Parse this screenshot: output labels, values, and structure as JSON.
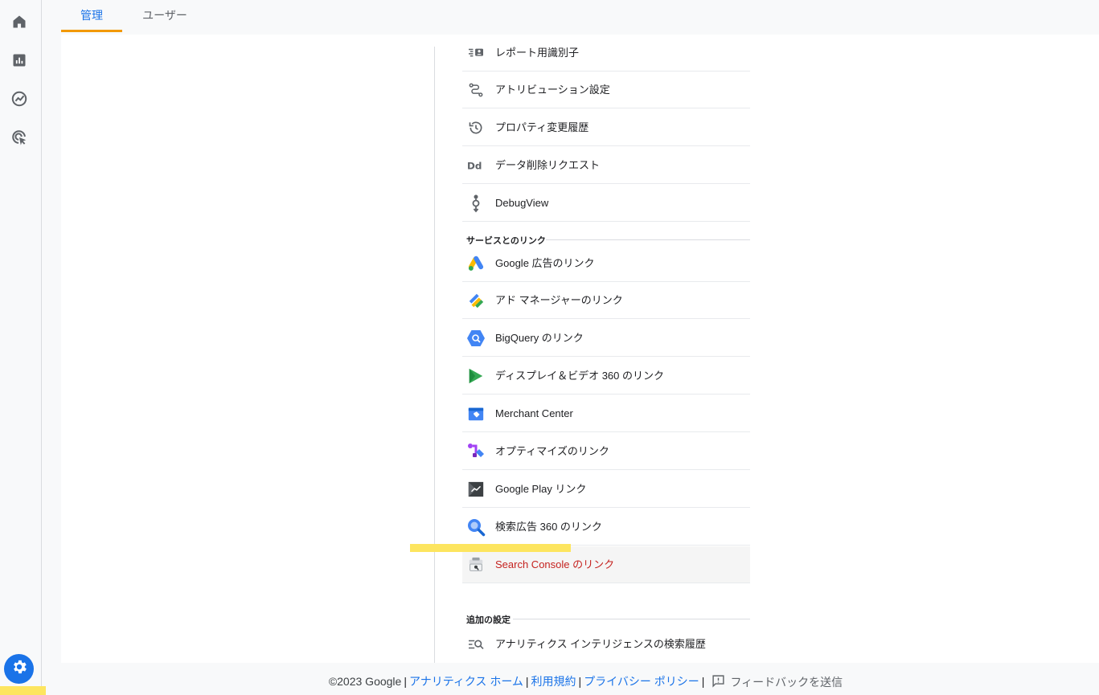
{
  "tabs": [
    {
      "label": "管理",
      "active": true
    },
    {
      "label": "ユーザー",
      "active": false
    }
  ],
  "rail": {
    "icons": [
      "home-icon",
      "reports-icon",
      "explore-icon",
      "advertising-icon"
    ],
    "settings_icon": "gear-icon"
  },
  "property_items": [
    {
      "label": "レポート用識別子",
      "icon": "reporting-identity-icon"
    },
    {
      "label": "アトリビューション設定",
      "icon": "attribution-icon"
    },
    {
      "label": "プロパティ変更履歴",
      "icon": "history-icon"
    },
    {
      "label": "データ削除リクエスト",
      "icon": "data-deletion-icon"
    },
    {
      "label": "DebugView",
      "icon": "debugview-icon"
    }
  ],
  "sections": {
    "links_title": "サービスとのリンク",
    "additional_title": "追加の設定"
  },
  "link_items": [
    {
      "label": "Google 広告のリンク",
      "icon": "google-ads-icon"
    },
    {
      "label": "アド マネージャーのリンク",
      "icon": "ad-manager-icon"
    },
    {
      "label": "BigQuery のリンク",
      "icon": "bigquery-icon"
    },
    {
      "label": "ディスプレイ＆ビデオ 360 のリンク",
      "icon": "display-video-360-icon"
    },
    {
      "label": "Merchant Center",
      "icon": "merchant-center-icon"
    },
    {
      "label": "オプティマイズのリンク",
      "icon": "optimize-icon"
    },
    {
      "label": "Google Play リンク",
      "icon": "google-play-icon"
    },
    {
      "label": "検索広告 360 のリンク",
      "icon": "search-ads-360-icon"
    },
    {
      "label": "Search Console のリンク",
      "icon": "search-console-icon",
      "selected": true
    }
  ],
  "additional_items": [
    {
      "label": "アナリティクス インテリジェンスの検索履歴",
      "icon": "intelligence-search-history-icon"
    }
  ],
  "footer": {
    "copyright": "©2023 Google",
    "analytics_home": "アナリティクス ホーム",
    "terms": "利用規約",
    "privacy": "プライバシー ポリシー",
    "feedback": "フィードバックを送信"
  },
  "colors": {
    "accent": "#1a73e8",
    "tab_indicator": "#f29900",
    "selected_text": "#c5221f",
    "highlight": "#fde55f"
  }
}
